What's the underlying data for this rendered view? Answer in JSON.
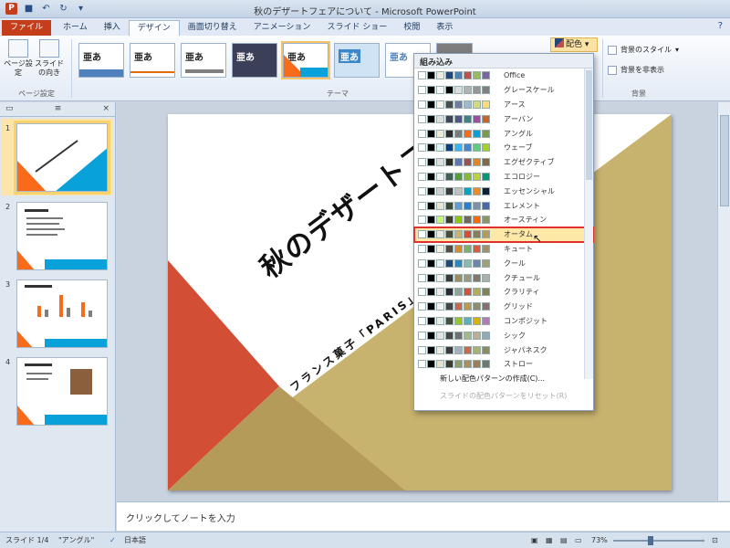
{
  "window": {
    "title": "秋のデザートフェアについて - Microsoft PowerPoint",
    "qat_icons": [
      "powerpoint-app-icon",
      "save-icon",
      "undo-icon",
      "redo-icon",
      "customize-icon"
    ],
    "help_icon": "help-icon"
  },
  "ribbon": {
    "tabs": [
      "ファイル",
      "ホーム",
      "挿入",
      "デザイン",
      "画面切り替え",
      "アニメーション",
      "スライド ショー",
      "校閲",
      "表示"
    ],
    "active_tab": "デザイン",
    "page_setup": {
      "btn1": "ページ設定",
      "btn2": "スライドの向き",
      "group": "ページ設定"
    },
    "theme_group_label": "テーマ",
    "theme_samples": [
      "亜あ",
      "亜あ",
      "亜あ",
      "亜あ",
      "亜あ",
      "亜あ",
      "亜あ"
    ],
    "colors_button": "配色",
    "background_styles": "背景のスタイル",
    "hide_background": "背景を非表示",
    "background_group": "背景"
  },
  "slides_pane": {
    "tabs": [
      "▭",
      "≡"
    ],
    "close": "×",
    "numbers": [
      "1",
      "2",
      "3",
      "4"
    ],
    "selected": 1
  },
  "slide": {
    "title": "秋のデザートフェア",
    "subtitle": "フランス菓子「PARIS」",
    "colors": {
      "orange": "#d24f36",
      "gold": "#c7b36d",
      "tan": "#b59b5a"
    }
  },
  "notes": {
    "placeholder": "クリックしてノートを入力"
  },
  "status": {
    "slide_counter": "スライド 1/4",
    "theme_name": "\"アングル\"",
    "language": "日本語",
    "zoom": "73%"
  },
  "dropdown": {
    "header": "組み込み",
    "highlighted": "オータム",
    "items": [
      {
        "name": "Office",
        "colors": [
          "#ffffff",
          "#000000",
          "#eeece1",
          "#1f497d",
          "#4f81bd",
          "#c0504d",
          "#9bbb59",
          "#8064a2"
        ]
      },
      {
        "name": "グレースケール",
        "colors": [
          "#ffffff",
          "#000000",
          "#f8f8f8",
          "#000000",
          "#dddddd",
          "#b2b2b2",
          "#969696",
          "#808080"
        ]
      },
      {
        "name": "アース",
        "colors": [
          "#ffffff",
          "#000000",
          "#f8f2e8",
          "#494f4f",
          "#727ca3",
          "#9fb8cd",
          "#d2da7a",
          "#fada7a"
        ]
      },
      {
        "name": "アーバン",
        "colors": [
          "#ffffff",
          "#000000",
          "#dedede",
          "#424456",
          "#53548a",
          "#438086",
          "#a04da3",
          "#c4652d"
        ]
      },
      {
        "name": "アングル",
        "colors": [
          "#ffffff",
          "#000000",
          "#f0e9d7",
          "#2c2c2c",
          "#797b7e",
          "#f96a1b",
          "#08a1d9",
          "#7c984a"
        ]
      },
      {
        "name": "ウェーブ",
        "colors": [
          "#ffffff",
          "#000000",
          "#dbf5f9",
          "#073e87",
          "#31b6fd",
          "#4584d3",
          "#5bd078",
          "#a5d028"
        ]
      },
      {
        "name": "エグゼクティブ",
        "colors": [
          "#ffffff",
          "#000000",
          "#dfdfdf",
          "#2f2b20",
          "#6076b4",
          "#9c5252",
          "#e68422",
          "#846648"
        ]
      },
      {
        "name": "エコロジー",
        "colors": [
          "#ffffff",
          "#000000",
          "#f2f2f2",
          "#455f51",
          "#549e39",
          "#8ab833",
          "#c0cf3a",
          "#029676"
        ]
      },
      {
        "name": "エッセンシャル",
        "colors": [
          "#ffffff",
          "#000000",
          "#d4d2d0",
          "#3a3a3a",
          "#c0c0c0",
          "#00a5c8",
          "#ee8924",
          "#0e1e38"
        ]
      },
      {
        "name": "エレメント",
        "colors": [
          "#ffffff",
          "#000000",
          "#e8e5d6",
          "#3c4b33",
          "#629dd1",
          "#297fd5",
          "#7f8fa9",
          "#4a66ac"
        ]
      },
      {
        "name": "オースティン",
        "colors": [
          "#ffffff",
          "#000000",
          "#caf278",
          "#3e3d2d",
          "#94c600",
          "#71685a",
          "#ff6700",
          "#909465"
        ]
      },
      {
        "name": "オータム",
        "colors": [
          "#ffffff",
          "#000000",
          "#eeece1",
          "#4f4a36",
          "#c7b36d",
          "#d24f36",
          "#8a7d54",
          "#b59b5a"
        ]
      },
      {
        "name": "キュート",
        "colors": [
          "#ffffff",
          "#000000",
          "#f3f0e2",
          "#564b3c",
          "#d78a2c",
          "#7fb06a",
          "#dc5a3c",
          "#a28f6c"
        ]
      },
      {
        "name": "クール",
        "colors": [
          "#ffffff",
          "#000000",
          "#e7f3f6",
          "#1f497d",
          "#2d87c0",
          "#8ab9ad",
          "#6b86a6",
          "#a49f7b"
        ]
      },
      {
        "name": "クチュール",
        "colors": [
          "#ffffff",
          "#000000",
          "#f2f2ec",
          "#3c3a38",
          "#9e8e5c",
          "#a09781",
          "#85776d",
          "#aeafa9"
        ]
      },
      {
        "name": "クラリティ",
        "colors": [
          "#ffffff",
          "#000000",
          "#efebe9",
          "#292934",
          "#93a299",
          "#cf543f",
          "#b5ae53",
          "#848058"
        ]
      },
      {
        "name": "グリッド",
        "colors": [
          "#ffffff",
          "#000000",
          "#f2f2f2",
          "#454545",
          "#c66951",
          "#bf974d",
          "#928b70",
          "#87706b"
        ]
      },
      {
        "name": "コンポジット",
        "colors": [
          "#ffffff",
          "#000000",
          "#e7ece4",
          "#45513d",
          "#98c723",
          "#59b0b9",
          "#deae00",
          "#b77bb4"
        ]
      },
      {
        "name": "シック",
        "colors": [
          "#ffffff",
          "#000000",
          "#e3e3e3",
          "#474747",
          "#6f6f74",
          "#a7b789",
          "#beae98",
          "#92a9b9"
        ]
      },
      {
        "name": "ジャパネスク",
        "colors": [
          "#ffffff",
          "#000000",
          "#eeebe4",
          "#3a3a3a",
          "#a6b0ba",
          "#c46a4f",
          "#a8b36d",
          "#8f8a66"
        ]
      },
      {
        "name": "ストロー",
        "colors": [
          "#ffffff",
          "#000000",
          "#e6e0cc",
          "#3d3b2f",
          "#8d9c6a",
          "#ad8e5f",
          "#a07c55",
          "#6f7a6c"
        ]
      }
    ],
    "create_new": "新しい配色パターンの作成(C)...",
    "reset": "スライドの配色パターンをリセット(R)"
  }
}
